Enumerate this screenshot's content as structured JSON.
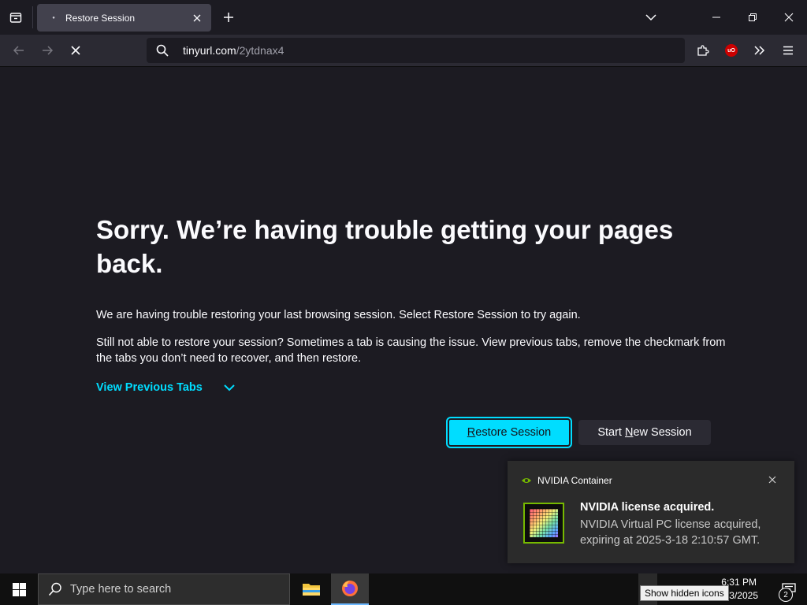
{
  "browser": {
    "tab": {
      "title": "Restore Session"
    },
    "url": {
      "host": "tinyurl.com",
      "path": "/2ytdnax4"
    },
    "extension_badge": "uO"
  },
  "page": {
    "title": "Sorry. We’re having trouble getting your pages back.",
    "paragraph1": "We are having trouble restoring your last browsing session. Select Restore Session to try again.",
    "paragraph2": "Still not able to restore your session? Sometimes a tab is causing the issue. View previous tabs, remove the checkmark from the tabs you don’t need to recover, and then restore.",
    "view_previous_tabs": "View Previous Tabs",
    "restore_button": "Restore Session",
    "new_session_prefix": "Start ",
    "new_session_accel": "N",
    "new_session_suffix": "ew Session"
  },
  "notification": {
    "app_name": "NVIDIA Container",
    "title": "NVIDIA license acquired.",
    "body": "NVIDIA Virtual PC license acquired, expiring at 2025-3-18 2:10:57 GMT."
  },
  "taskbar": {
    "search_placeholder": "Type here to search",
    "time": "6:31 PM",
    "date": "3/3/2025",
    "tooltip": "Show hidden icons",
    "notification_count": "2"
  },
  "colors": {
    "accent": "#00ddff",
    "background": "#1c1b22",
    "toolbar": "#2b2a33",
    "nvidia_green": "#76b900"
  },
  "icons": {
    "tab_list": "tab-list-icon",
    "new_tab": "plus-icon",
    "back": "back-arrow-icon",
    "forward": "forward-arrow-icon",
    "stop": "stop-icon",
    "search": "search-icon",
    "extensions": "puzzle-icon",
    "overflow": "chevron-double-right-icon",
    "menu": "hamburger-icon",
    "start": "windows-logo-icon",
    "file_explorer": "folder-icon",
    "firefox": "firefox-icon"
  }
}
